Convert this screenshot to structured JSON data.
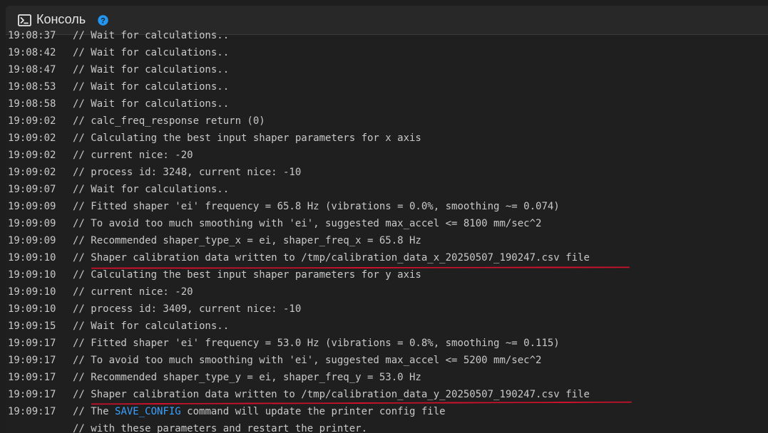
{
  "header": {
    "title": "Консоль",
    "icon": "terminal-icon",
    "help_icon": "help-icon",
    "help_color": "#2196f3"
  },
  "log_lines": [
    {
      "time": "19:08:37",
      "msg": "// Wait for calculations.."
    },
    {
      "time": "19:08:42",
      "msg": "// Wait for calculations.."
    },
    {
      "time": "19:08:47",
      "msg": "// Wait for calculations.."
    },
    {
      "time": "19:08:53",
      "msg": "// Wait for calculations.."
    },
    {
      "time": "19:08:58",
      "msg": "// Wait for calculations.."
    },
    {
      "time": "19:09:02",
      "msg": "// calc_freq_response return (0)"
    },
    {
      "time": "19:09:02",
      "msg": "// Calculating the best input shaper parameters for x axis"
    },
    {
      "time": "19:09:02",
      "msg": "// current nice: -20"
    },
    {
      "time": "19:09:02",
      "msg": "// process id: 3248, current nice: -10"
    },
    {
      "time": "19:09:07",
      "msg": "// Wait for calculations.."
    },
    {
      "time": "19:09:09",
      "msg": "// Fitted shaper 'ei' frequency = 65.8 Hz (vibrations = 0.0%, smoothing ~= 0.074)"
    },
    {
      "time": "19:09:09",
      "msg": "// To avoid too much smoothing with 'ei', suggested max_accel <= 8100 mm/sec^2"
    },
    {
      "time": "19:09:09",
      "msg": "// Recommended shaper_type_x = ei, shaper_freq_x = 65.8 Hz"
    },
    {
      "time": "19:09:10",
      "msg": "// Shaper calibration data written to /tmp/calibration_data_x_20250507_190247.csv file"
    },
    {
      "time": "19:09:10",
      "msg": "// Calculating the best input shaper parameters for y axis"
    },
    {
      "time": "19:09:10",
      "msg": "// current nice: -20"
    },
    {
      "time": "19:09:10",
      "msg": "// process id: 3409, current nice: -10"
    },
    {
      "time": "19:09:15",
      "msg": "// Wait for calculations.."
    },
    {
      "time": "19:09:17",
      "msg": "// Fitted shaper 'ei' frequency = 53.0 Hz (vibrations = 0.8%, smoothing ~= 0.115)"
    },
    {
      "time": "19:09:17",
      "msg": "// To avoid too much smoothing with 'ei', suggested max_accel <= 5200 mm/sec^2"
    },
    {
      "time": "19:09:17",
      "msg": "// Recommended shaper_type_y = ei, shaper_freq_y = 53.0 Hz"
    },
    {
      "time": "19:09:17",
      "msg": "// Shaper calibration data written to /tmp/calibration_data_y_20250507_190247.csv file"
    },
    {
      "time": "19:09:17",
      "msg_prefix": "// The ",
      "msg_link": "SAVE_CONFIG",
      "msg_suffix": " command will update the printer config file"
    },
    {
      "time": "",
      "msg": "// with these parameters and restart the printer."
    }
  ],
  "colors": {
    "background": "#1f1f1f",
    "header_background": "#282828",
    "text": "#c9c9c9",
    "link": "#3aa1ff",
    "annotation": "#d0112b"
  }
}
